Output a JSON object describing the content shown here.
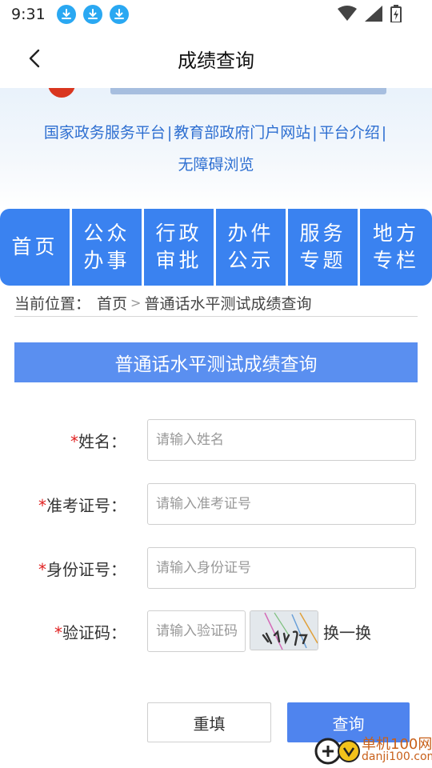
{
  "status_bar": {
    "time": "9:31"
  },
  "header": {
    "title": "成绩查询"
  },
  "banner": {
    "links_row1": [
      "国家政务服务平台",
      "教育部政府门户网站",
      "平台介绍"
    ],
    "links_row2": [
      "无障碍浏览"
    ],
    "separator": "|"
  },
  "nav": {
    "items": [
      {
        "line1": "首页",
        "line2": ""
      },
      {
        "line1": "公众",
        "line2": "办事"
      },
      {
        "line1": "行政",
        "line2": "审批"
      },
      {
        "line1": "办件",
        "line2": "公示"
      },
      {
        "line1": "服务",
        "line2": "专题"
      },
      {
        "line1": "地方",
        "line2": "专栏"
      }
    ]
  },
  "breadcrumb": {
    "prefix": "当前位置：",
    "home": "首页",
    "arrow": ">",
    "current": "普通话水平测试成绩查询"
  },
  "section": {
    "title": "普通话水平测试成绩查询"
  },
  "form": {
    "required_mark": "*",
    "name_label": "姓名：",
    "name_placeholder": "请输入姓名",
    "ticket_label": "准考证号：",
    "ticket_placeholder": "请输入准考证号",
    "id_label": "身份证号：",
    "id_placeholder": "请输入身份证号",
    "captcha_label": "验证码：",
    "captcha_placeholder": "请输入验证码",
    "refresh_label": "换一换"
  },
  "buttons": {
    "reset": "重填",
    "query": "查询"
  },
  "watermark": {
    "line1": "单机100网",
    "line2": "danji100.com"
  },
  "colors": {
    "nav_blue": "#3a82f0",
    "section_blue": "#5a8ff0",
    "link_blue": "#2e6fd1",
    "query_button": "#4f84ee",
    "required_red": "#e02020"
  },
  "icons": [
    "download-icon",
    "wifi-icon",
    "signal-icon",
    "battery-icon",
    "back-arrow-icon",
    "captcha-image",
    "watermark-logo"
  ]
}
